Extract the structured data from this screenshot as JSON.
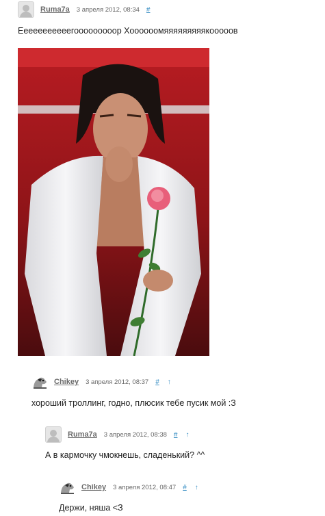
{
  "comments": [
    {
      "author": "Ruma7a",
      "date": "3 апреля 2012, 08:34",
      "hash": "#",
      "up": "",
      "text": "Ееееееееееегооооооооор Хоооооомяяяяяяяяякооооов"
    },
    {
      "author": "Chikey",
      "date": "3 апреля 2012, 08:37",
      "hash": "#",
      "up": "↑",
      "text": "хороший троллинг, годно, плюсик тебе пусик мой :З"
    },
    {
      "author": "Ruma7a",
      "date": "3 апреля 2012, 08:38",
      "hash": "#",
      "up": "↑",
      "text": "А в кармочку чмокнешь, сладенький? ^^"
    },
    {
      "author": "Chikey",
      "date": "3 апреля 2012, 08:47",
      "hash": "#",
      "up": "↑",
      "text": "Держи, няша <З"
    }
  ],
  "colors": {
    "link": "#3a8fc4",
    "author": "#6b6b6b",
    "photo_bg": "#7a0f12"
  },
  "icons": [
    "default-avatar-icon",
    "dog-avatar-icon"
  ]
}
